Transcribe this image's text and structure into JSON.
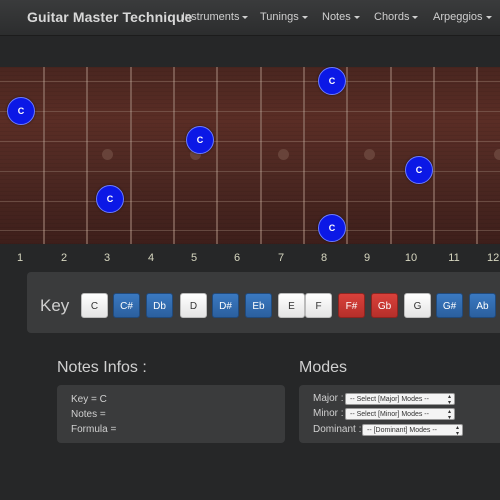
{
  "navbar": {
    "brand": "Guitar Master Technique",
    "items": [
      "Instruments",
      "Tunings",
      "Notes",
      "Chords",
      "Arpeggios"
    ]
  },
  "fretboard": {
    "note_label": "C",
    "fret_numbers": [
      "1",
      "2",
      "3",
      "4",
      "5",
      "6",
      "7",
      "8",
      "9",
      "10",
      "11",
      "12"
    ]
  },
  "key": {
    "label": "Key",
    "buttons": [
      {
        "label": "C",
        "style": "white"
      },
      {
        "label": "C#",
        "style": "blue"
      },
      {
        "label": "Db",
        "style": "blue"
      },
      {
        "label": "D",
        "style": "white"
      },
      {
        "label": "D#",
        "style": "blue"
      },
      {
        "label": "Eb",
        "style": "blue"
      },
      {
        "label": "E",
        "style": "white"
      },
      {
        "label": "F",
        "style": "white"
      },
      {
        "label": "F#",
        "style": "red"
      },
      {
        "label": "Gb",
        "style": "red"
      },
      {
        "label": "G",
        "style": "white"
      },
      {
        "label": "G#",
        "style": "blue"
      },
      {
        "label": "Ab",
        "style": "blue"
      }
    ]
  },
  "notes_infos": {
    "title": "Notes Infos :",
    "key_line": "Key = C",
    "notes_line": "Notes =",
    "formula_line": "Formula ="
  },
  "modes": {
    "title": "Modes",
    "major_label": "Major :",
    "major_select": "-- Select [Major] Modes --",
    "minor_label": "Minor :",
    "minor_select": "-- Select [Minor] Modes --",
    "dominant_label": "Dominant :",
    "dominant_select": "-- [Dominant] Modes --"
  },
  "colors": {
    "note_dot": "#0b18e6",
    "key_blue": "#3a79c1",
    "key_red": "#d9413b",
    "fret_number": "#d7d7c0"
  }
}
